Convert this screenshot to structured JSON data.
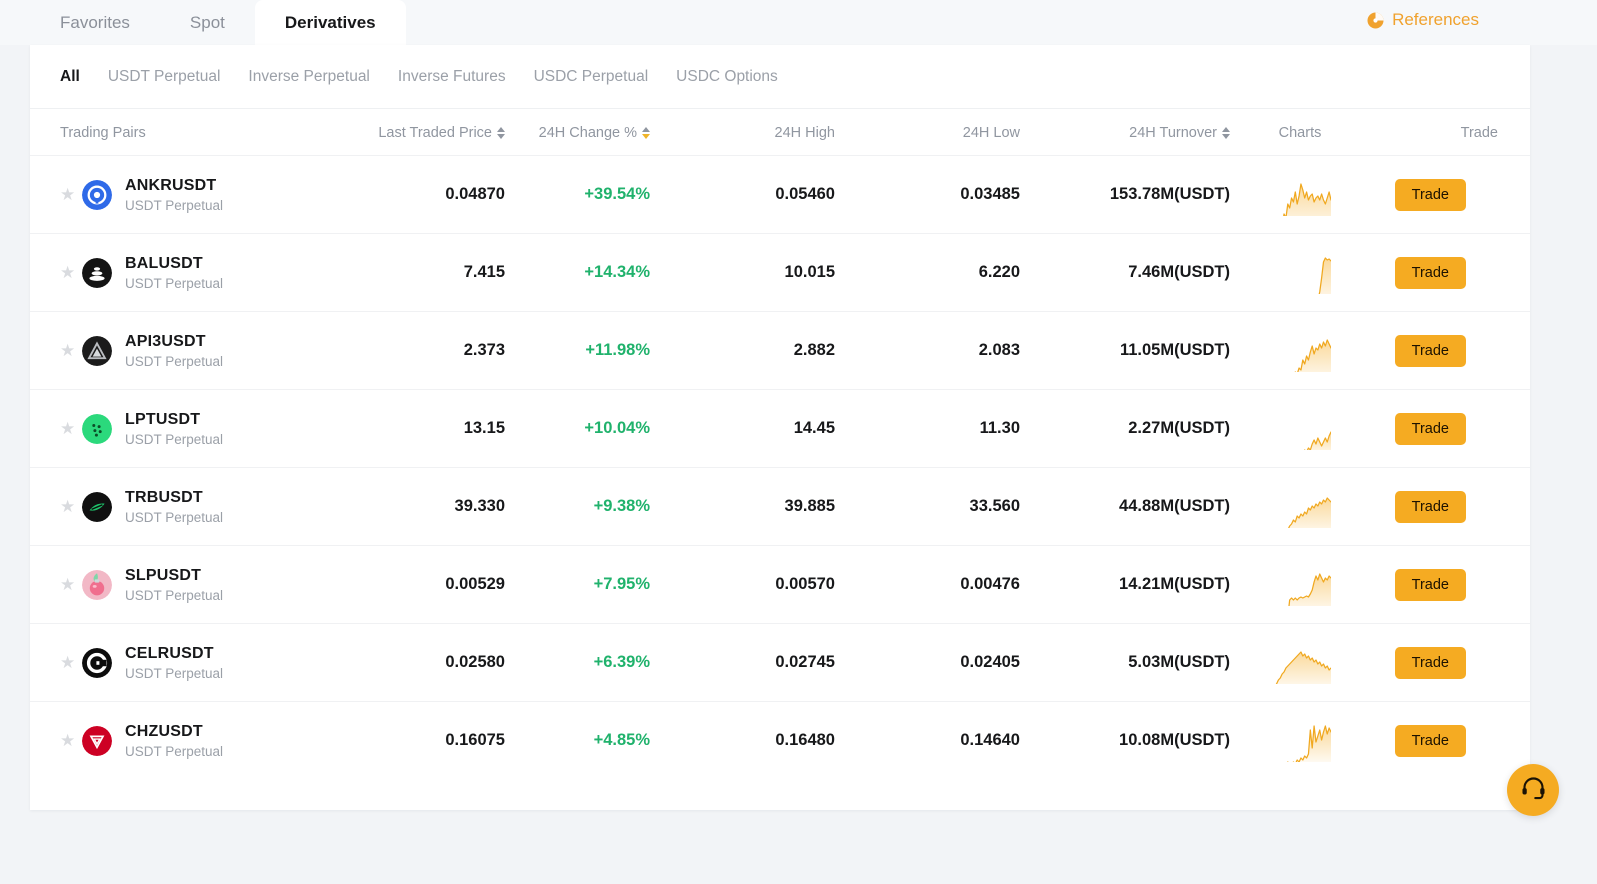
{
  "topbar": {
    "tabs": [
      {
        "label": "Favorites",
        "active": false
      },
      {
        "label": "Spot",
        "active": false
      },
      {
        "label": "Derivatives",
        "active": true
      }
    ],
    "references": {
      "label": "References",
      "icon": "pie-chart-icon",
      "color": "#f0a22e"
    }
  },
  "subtabs": [
    {
      "label": "All",
      "active": true
    },
    {
      "label": "USDT Perpetual",
      "active": false
    },
    {
      "label": "Inverse Perpetual",
      "active": false
    },
    {
      "label": "Inverse Futures",
      "active": false
    },
    {
      "label": "USDC Perpetual",
      "active": false
    },
    {
      "label": "USDC Options",
      "active": false
    }
  ],
  "table": {
    "headers": {
      "pair": "Trading Pairs",
      "price": "Last Traded Price",
      "change": "24H Change %",
      "high": "24H High",
      "low": "24H Low",
      "turnover": "24H Turnover",
      "charts": "Charts",
      "trade": "Trade"
    },
    "sortable": [
      "price",
      "change",
      "turnover"
    ],
    "active_sort": {
      "column": "change",
      "direction": "desc"
    },
    "trade_button_label": "Trade",
    "rows": [
      {
        "symbol": "ANKRUSDT",
        "contract": "USDT Perpetual",
        "last_price": "0.04870",
        "change_pct": "+39.54%",
        "high": "0.05460",
        "low": "0.03485",
        "turnover": "153.78M(USDT)",
        "icon": "ankr-coin-icon",
        "icon_bg": "#2f6ae8",
        "spark": [
          62,
          60,
          63,
          59,
          58,
          55,
          48,
          52,
          40,
          44,
          30,
          34,
          24,
          28,
          18,
          30,
          22,
          10,
          16,
          24,
          18,
          26,
          22,
          20,
          28,
          24,
          22,
          26,
          20,
          26,
          30,
          24,
          18,
          26
        ]
      },
      {
        "symbol": "BALUSDT",
        "contract": "USDT Perpetual",
        "last_price": "7.415",
        "change_pct": "+14.34%",
        "high": "10.015",
        "low": "6.220",
        "turnover": "7.46M(USDT)",
        "icon": "bal-coin-icon",
        "icon_bg": "#141414",
        "spark": [
          56,
          55,
          57,
          56,
          58,
          56,
          57,
          55,
          56,
          57,
          56,
          58,
          57,
          56,
          57,
          58,
          57,
          56,
          57,
          56,
          58,
          57,
          56,
          55,
          54,
          52,
          48,
          40,
          26,
          10,
          6,
          8,
          7,
          9
        ]
      },
      {
        "symbol": "API3USDT",
        "contract": "USDT Perpetual",
        "last_price": "2.373",
        "change_pct": "+11.98%",
        "high": "2.882",
        "low": "2.083",
        "turnover": "11.05M(USDT)",
        "icon": "api3-coin-icon",
        "icon_bg": "#1b1b1b",
        "spark": [
          56,
          55,
          57,
          54,
          56,
          53,
          55,
          52,
          54,
          50,
          52,
          49,
          46,
          48,
          42,
          44,
          38,
          40,
          30,
          34,
          26,
          30,
          22,
          16,
          24,
          18,
          20,
          14,
          18,
          12,
          16,
          10,
          14,
          18
        ]
      },
      {
        "symbol": "LPTUSDT",
        "contract": "USDT Perpetual",
        "last_price": "13.15",
        "change_pct": "+10.04%",
        "high": "14.45",
        "low": "11.30",
        "turnover": "2.27M(USDT)",
        "icon": "lpt-coin-icon",
        "icon_bg": "#2bd97c",
        "spark": [
          50,
          49,
          50,
          48,
          50,
          49,
          48,
          50,
          49,
          48,
          49,
          47,
          48,
          46,
          47,
          45,
          46,
          44,
          45,
          42,
          44,
          40,
          42,
          36,
          32,
          36,
          30,
          34,
          38,
          34,
          30,
          34,
          28,
          24
        ]
      },
      {
        "symbol": "TRBUSDT",
        "contract": "USDT Perpetual",
        "last_price": "39.330",
        "change_pct": "+9.38%",
        "high": "39.885",
        "low": "33.560",
        "turnover": "44.88M(USDT)",
        "icon": "trb-coin-icon",
        "icon_bg": "#101010",
        "spark": [
          54,
          53,
          54,
          52,
          53,
          51,
          52,
          50,
          48,
          46,
          44,
          40,
          38,
          34,
          36,
          30,
          32,
          28,
          30,
          26,
          28,
          22,
          24,
          20,
          22,
          18,
          20,
          16,
          18,
          14,
          16,
          12,
          14,
          16
        ]
      },
      {
        "symbol": "SLPUSDT",
        "contract": "USDT Perpetual",
        "last_price": "0.00529",
        "change_pct": "+7.95%",
        "high": "0.00570",
        "low": "0.00476",
        "turnover": "14.21M(USDT)",
        "icon": "slp-coin-icon",
        "icon_bg": "#f2b8c6",
        "spark": [
          54,
          53,
          54,
          53,
          54,
          52,
          53,
          52,
          53,
          52,
          53,
          36,
          34,
          36,
          34,
          36,
          34,
          33,
          34,
          33,
          32,
          33,
          30,
          26,
          18,
          12,
          16,
          10,
          14,
          18,
          14,
          16,
          12,
          14
        ]
      },
      {
        "symbol": "CELRUSDT",
        "contract": "USDT Perpetual",
        "last_price": "0.02580",
        "change_pct": "+6.39%",
        "high": "0.02745",
        "low": "0.02405",
        "turnover": "5.03M(USDT)",
        "icon": "celr-coin-icon",
        "icon_bg": "#0d0d0d",
        "spark": [
          52,
          50,
          48,
          44,
          42,
          38,
          36,
          32,
          30,
          26,
          24,
          22,
          20,
          18,
          16,
          14,
          12,
          10,
          14,
          12,
          16,
          14,
          18,
          16,
          20,
          18,
          22,
          20,
          24,
          22,
          26,
          24,
          28,
          26
        ]
      },
      {
        "symbol": "CHZUSDT",
        "contract": "USDT Perpetual",
        "last_price": "0.16075",
        "change_pct": "+4.85%",
        "high": "0.16480",
        "low": "0.14640",
        "turnover": "10.08M(USDT)",
        "icon": "chz-coin-icon",
        "icon_bg": "#cd0124",
        "spark": [
          48,
          47,
          46,
          48,
          46,
          47,
          45,
          48,
          44,
          46,
          42,
          46,
          44,
          42,
          44,
          40,
          42,
          38,
          40,
          36,
          38,
          34,
          10,
          28,
          6,
          22,
          16,
          10,
          20,
          12,
          6,
          14,
          8,
          12
        ]
      }
    ]
  },
  "support": {
    "icon": "headset-icon",
    "color": "#f5ab22"
  },
  "theme": {
    "accent": "#f5ab22",
    "positive": "#20b26c",
    "text": "#17181a",
    "muted": "#9ba0a8",
    "page_bg": "#f2f4f7",
    "card_bg": "#ffffff"
  }
}
